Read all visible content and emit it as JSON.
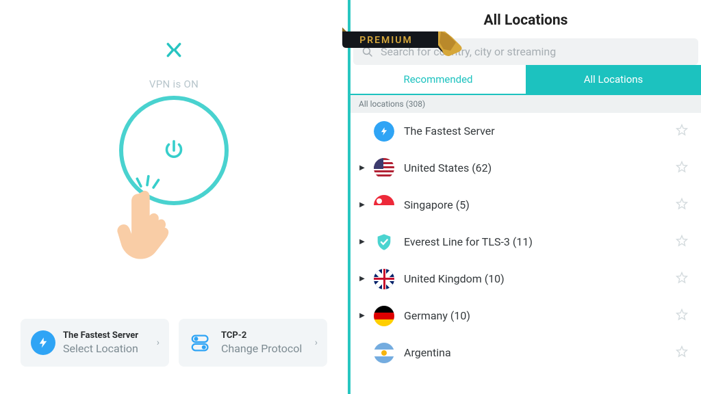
{
  "left": {
    "status": "VPN is ON",
    "server_card": {
      "title": "The Fastest Server",
      "action": "Select Location"
    },
    "protocol_card": {
      "title": "TCP-2",
      "action": "Change Protocol"
    }
  },
  "right": {
    "page_title": "All Locations",
    "premium_badge": "PREMIUM",
    "search_placeholder": "Search for country, city or streaming",
    "tabs": {
      "recommended": "Recommended",
      "all": "All Locations"
    },
    "count_label": "All locations (308)",
    "items": [
      {
        "label": "The Fastest Server",
        "expandable": false,
        "flag": "bolt"
      },
      {
        "label": "United States (62)",
        "expandable": true,
        "flag": "us"
      },
      {
        "label": "Singapore (5)",
        "expandable": true,
        "flag": "sg"
      },
      {
        "label": "Everest Line for TLS-3 (11)",
        "expandable": true,
        "flag": "shield"
      },
      {
        "label": "United Kingdom (10)",
        "expandable": true,
        "flag": "uk"
      },
      {
        "label": "Germany (10)",
        "expandable": true,
        "flag": "de"
      },
      {
        "label": "Argentina",
        "expandable": false,
        "flag": "ar"
      }
    ]
  },
  "colors": {
    "accent": "#1cc2bf",
    "blue": "#2fa4f5"
  }
}
